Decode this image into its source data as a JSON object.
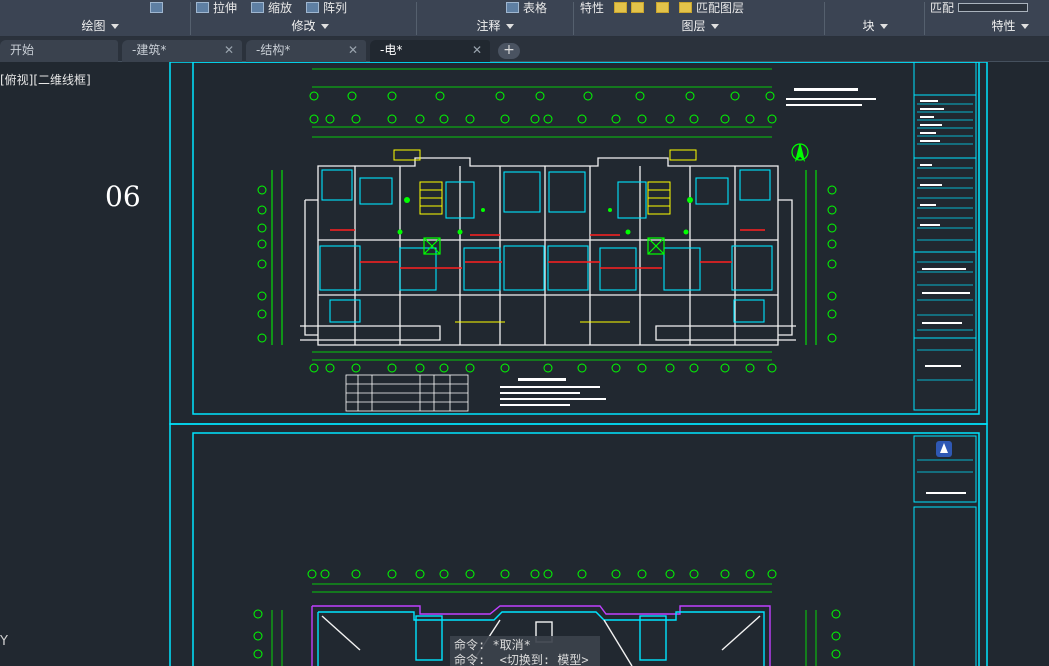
{
  "ribbon": {
    "tools": {
      "stretch": "拉伸",
      "scale": "缩放",
      "array": "阵列",
      "table": "表格",
      "properties": "特性",
      "match_layer": "匹配图层",
      "match": "匹配"
    },
    "panels": {
      "draw": "绘图",
      "modify": "修改",
      "annotation": "注释",
      "layers": "图层",
      "block": "块",
      "properties": "特性"
    }
  },
  "tabs": [
    {
      "label": "开始",
      "closable": false,
      "active": false
    },
    {
      "label": "-建筑*",
      "closable": true,
      "active": false
    },
    {
      "label": "-结构*",
      "closable": true,
      "active": false
    },
    {
      "label": "-电*",
      "closable": true,
      "active": true
    }
  ],
  "tab_close_glyph": "✕",
  "tab_add_glyph": "+",
  "viewport": {
    "view_label": "[俯视][二维线框]",
    "side_number": "06",
    "ucs_axis": "Y"
  },
  "command_line": {
    "line1": "命令: *取消*",
    "line2": "命令: _<切换到: 模型>"
  },
  "colors": {
    "background": "#212830",
    "ribbon": "#3b4453",
    "frame": "#00e5ff",
    "axis_green": "#00ff00",
    "wall_white": "#f2f2f2",
    "red_line": "#ff2020",
    "yellow": "#ffff00",
    "magenta": "#c040ff"
  },
  "icons": [
    "stretch-icon",
    "scale-icon",
    "array-icon",
    "table-icon",
    "properties-icon",
    "match-layer-icon",
    "add-tab-icon",
    "close-icon",
    "north-arrow-icon",
    "logo-icon"
  ]
}
